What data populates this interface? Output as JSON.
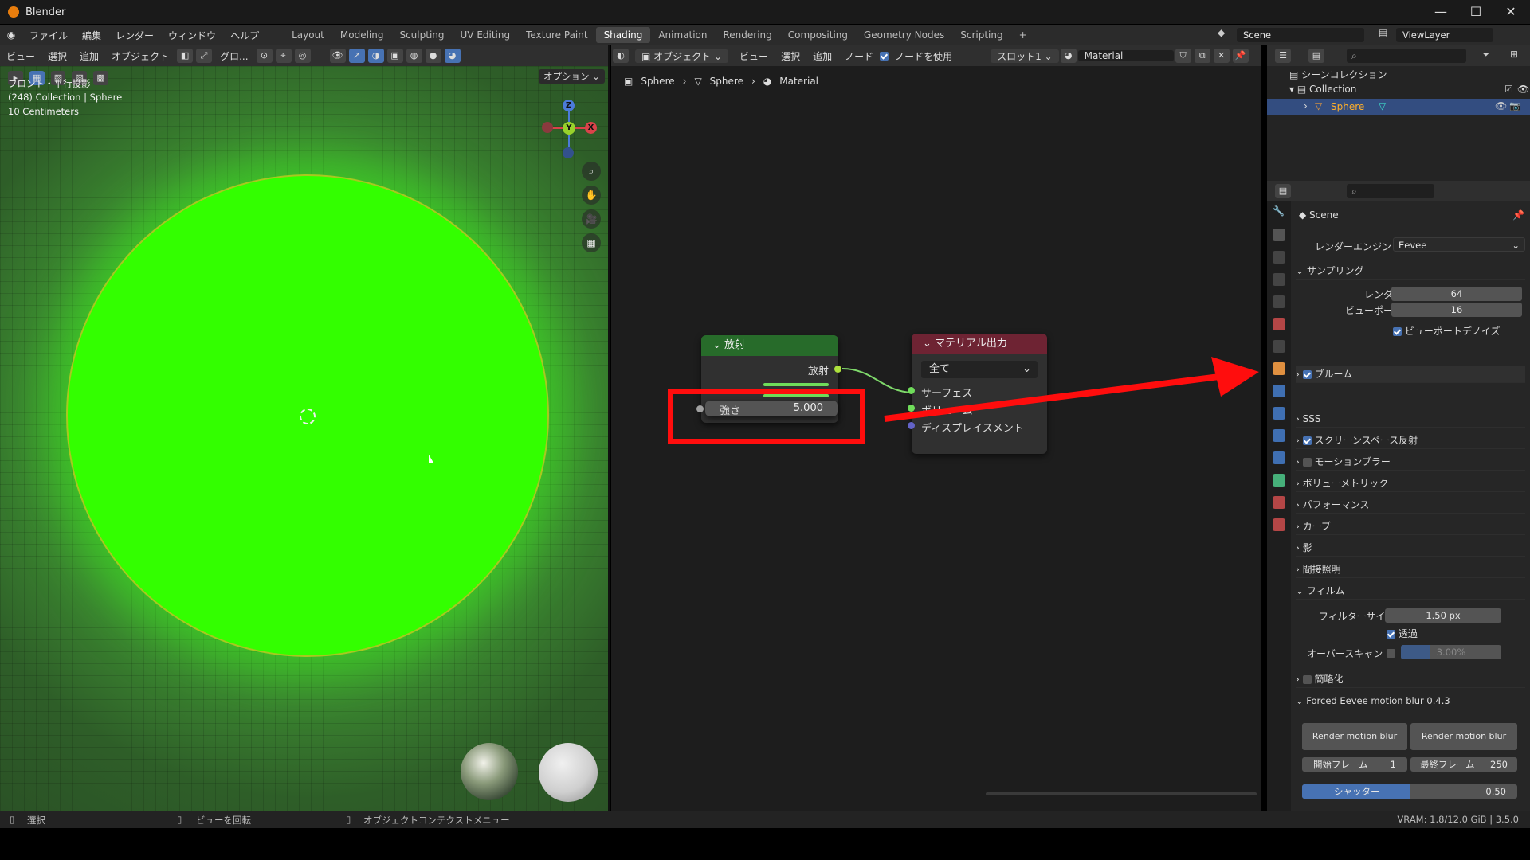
{
  "title_bar": {
    "title": "Blender"
  },
  "menu": [
    "ファイル",
    "編集",
    "レンダー",
    "ウィンドウ",
    "ヘルプ"
  ],
  "workspaces": [
    "Layout",
    "Modeling",
    "Sculpting",
    "UV Editing",
    "Texture Paint",
    "Shading",
    "Animation",
    "Rendering",
    "Compositing",
    "Geometry Nodes",
    "Scripting"
  ],
  "active_workspace": "Shading",
  "scene_field": "Scene",
  "viewlayer_field": "ViewLayer",
  "viewport": {
    "menu": [
      "ビュー",
      "選択",
      "追加",
      "オブジェクト"
    ],
    "transform_orient": "グロ...",
    "options_label": "オプション",
    "overlay_lines": [
      "フロント・平行投影",
      "(248) Collection | Sphere",
      "10 Centimeters"
    ],
    "axis_z": "Z",
    "axis_y": "Y",
    "axis_x": "X"
  },
  "node_editor": {
    "mode": "オブジェクト",
    "menu": [
      "ビュー",
      "選択",
      "追加",
      "ノード"
    ],
    "use_nodes_label": "ノードを使用",
    "slot": "スロット1",
    "material": "Material",
    "breadcrumb": [
      "Sphere",
      "Sphere",
      "Material"
    ],
    "emission_node": {
      "title": "放射",
      "output": "放射",
      "strength_label": "強さ",
      "strength_value": "5.000"
    },
    "output_node": {
      "title": "マテリアル出力",
      "target": "全て",
      "sockets": [
        "サーフェス",
        "ボリューム",
        "ディスプレイスメント"
      ]
    }
  },
  "outliner": {
    "scene_collection": "シーンコレクション",
    "collection": "Collection",
    "object": "Sphere"
  },
  "properties": {
    "scene": "Scene",
    "render_engine_label": "レンダーエンジン",
    "render_engine": "Eevee",
    "sampling": "サンプリング",
    "render_label": "レンダー",
    "render_samples": "64",
    "viewport_label": "ビューポート",
    "viewport_samples": "16",
    "viewport_denoise": "ビューポートデノイズ",
    "panels": [
      "ブルーム",
      "SSS",
      "スクリーンスペース反射",
      "モーションブラー",
      "ボリューメトリック",
      "パフォーマンス",
      "カーブ",
      "影",
      "間接照明"
    ],
    "film": "フィルム",
    "filter_size_label": "フィルターサイズ",
    "filter_size": "1.50 px",
    "transparent": "透過",
    "overscan_label": "オーバースキャン",
    "overscan": "3.00%",
    "simplify": "簡略化",
    "addon_panel": "Forced Eevee motion blur 0.4.3",
    "btn_frame": "Render motion blur frame",
    "btn_seq": "Render motion blur seq...",
    "start_frame_label": "開始フレーム",
    "start_frame": "1",
    "end_frame_label": "最終フレーム",
    "end_frame": "250",
    "shutter_label": "シャッター",
    "shutter": "0.50",
    "shutter_fraction": 0.5
  },
  "status": {
    "select": "選択",
    "rotate": "ビューを回転",
    "context": "オブジェクトコンテクストメニュー",
    "vram": "VRAM: 1.8/12.0 GiB | 3.5.0"
  },
  "colors": {
    "highlight": "#ff0d0d",
    "sphere": "#33ff00",
    "accent": "#4772b3"
  }
}
